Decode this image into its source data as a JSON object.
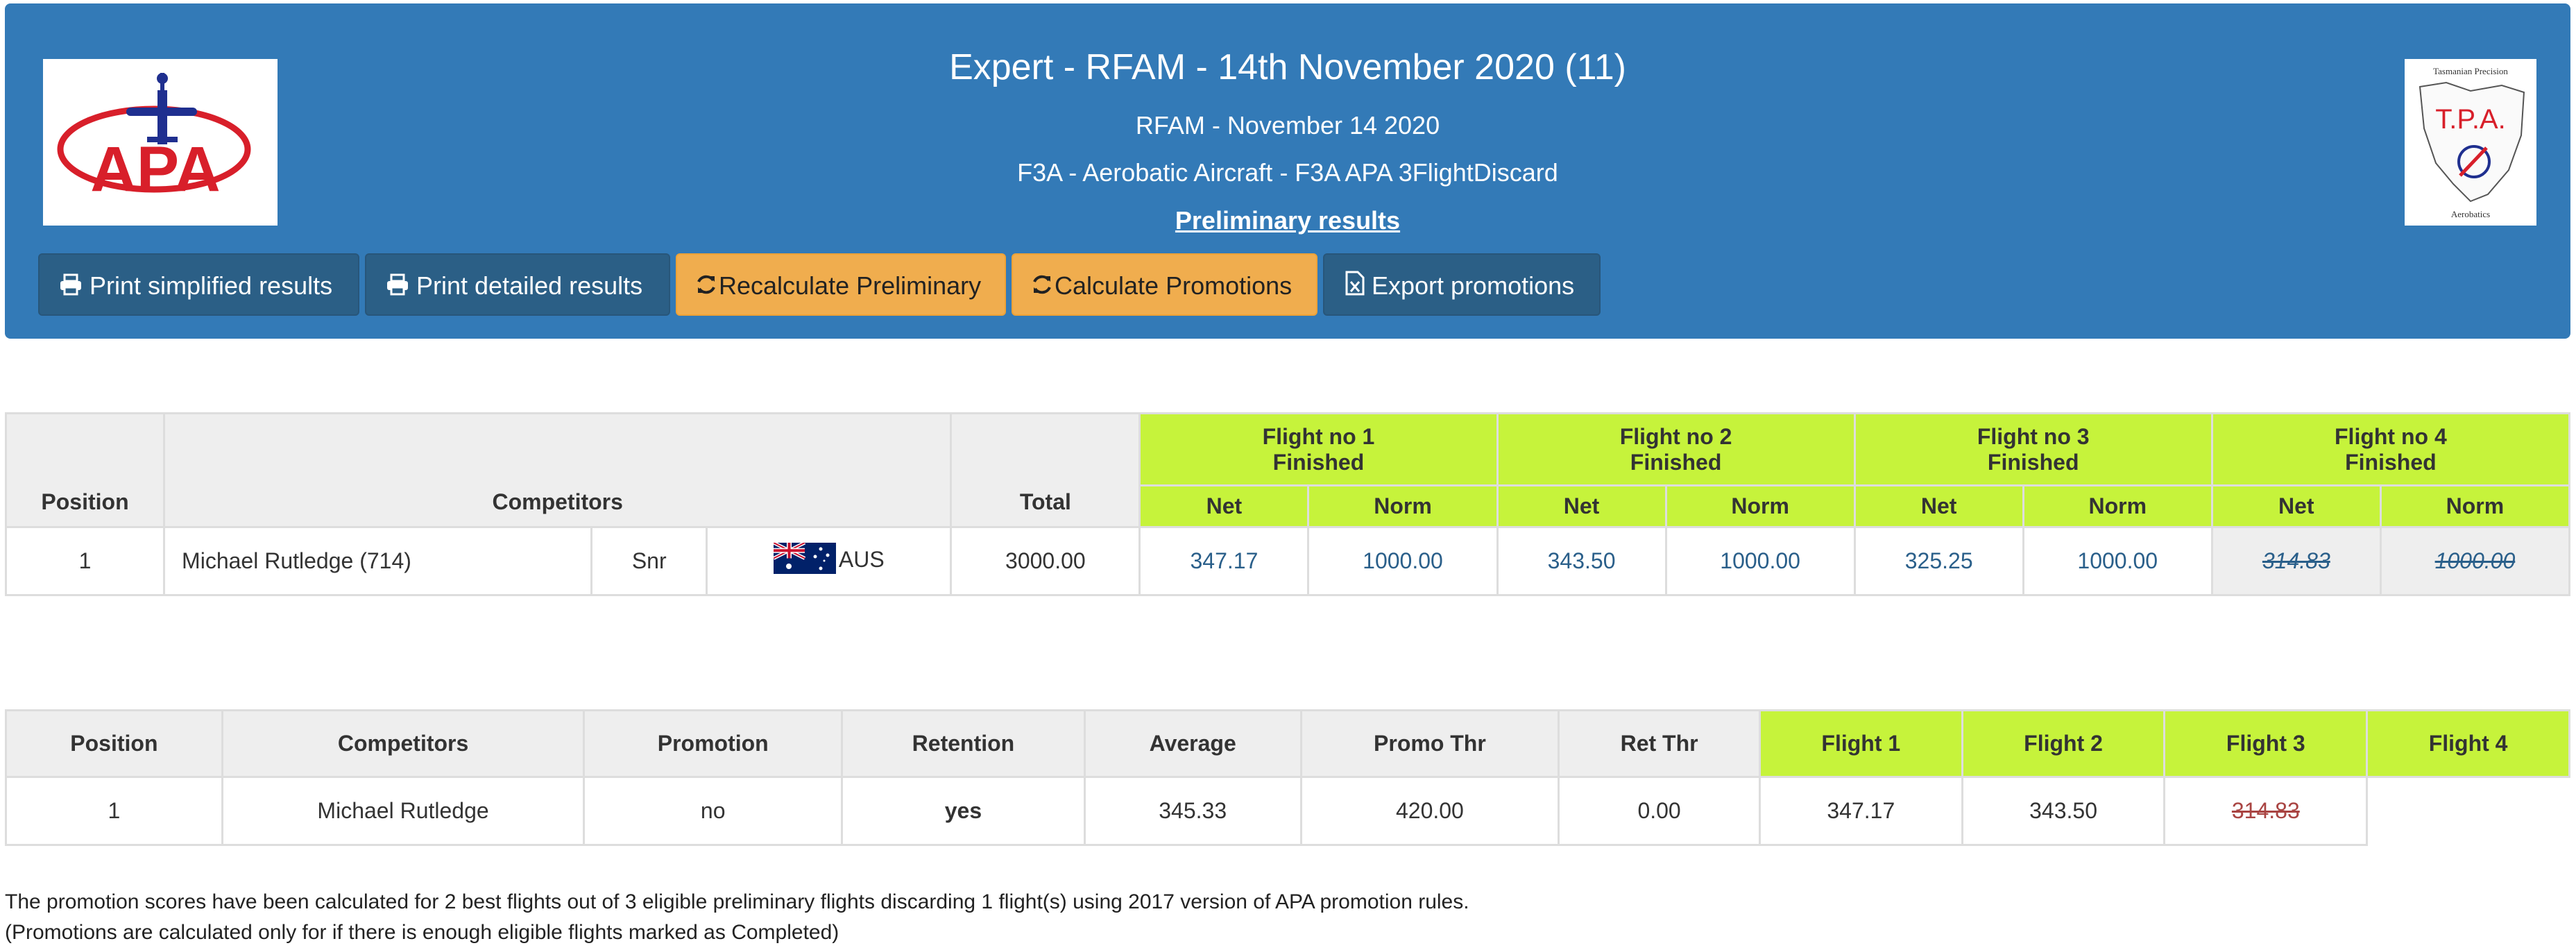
{
  "header": {
    "title": "Expert - RFAM - 14th November 2020 (11)",
    "subtitle": "RFAM - November 14 2020",
    "category": "F3A - Aerobatic Aircraft - F3A APA 3FlightDiscard",
    "results_link": "Preliminary results",
    "logo_left_text": "APA",
    "logo_right": {
      "top": "Tasmanian Precision",
      "mid": "T.P.A.",
      "bottom": "Aerobatics"
    }
  },
  "toolbar": {
    "print_simplified": "Print simplified results",
    "print_detailed": "Print detailed results",
    "recalc_prelim": "Recalculate Preliminary",
    "calc_promotions": "Calculate Promotions",
    "export_promotions": "Export promotions"
  },
  "results": {
    "headers": {
      "position": "Position",
      "competitors": "Competitors",
      "total": "Total",
      "net": "Net",
      "norm": "Norm"
    },
    "flights": [
      {
        "name": "Flight no 1",
        "status": "Finished"
      },
      {
        "name": "Flight no 2",
        "status": "Finished"
      },
      {
        "name": "Flight no 3",
        "status": "Finished"
      },
      {
        "name": "Flight no 4",
        "status": "Finished"
      }
    ],
    "rows": [
      {
        "position": "1",
        "name": "Michael Rutledge (714)",
        "class": "Snr",
        "country": "AUS",
        "total": "3000.00",
        "scores": [
          {
            "net": "347.17",
            "norm": "1000.00"
          },
          {
            "net": "343.50",
            "norm": "1000.00"
          },
          {
            "net": "325.25",
            "norm": "1000.00"
          },
          {
            "net": "314.83",
            "norm": "1000.00"
          }
        ]
      }
    ]
  },
  "promotions": {
    "headers": [
      "Position",
      "Competitors",
      "Promotion",
      "Retention",
      "Average",
      "Promo Thr",
      "Ret Thr",
      "Flight 1",
      "Flight 2",
      "Flight 3",
      "Flight 4"
    ],
    "rows": [
      {
        "position": "1",
        "name": "Michael Rutledge",
        "promotion": "no",
        "retention": "yes",
        "average": "345.33",
        "promo_thr": "420.00",
        "ret_thr": "0.00",
        "f1": "347.17",
        "f2": "343.50",
        "f3": "314.83"
      }
    ]
  },
  "notes": {
    "line1": "The promotion scores have been calculated for 2 best flights out of 3 eligible preliminary flights discarding 1 flight(s) using 2017 version of APA promotion rules.",
    "line2": "(Promotions are calculated only for if there is enough eligible flights marked as Completed)"
  },
  "colors": {
    "header_bg": "#337ab7",
    "flight_header": "#c6f33b",
    "warning_button": "#f0ad4e",
    "dark_button": "#2b5f86"
  }
}
